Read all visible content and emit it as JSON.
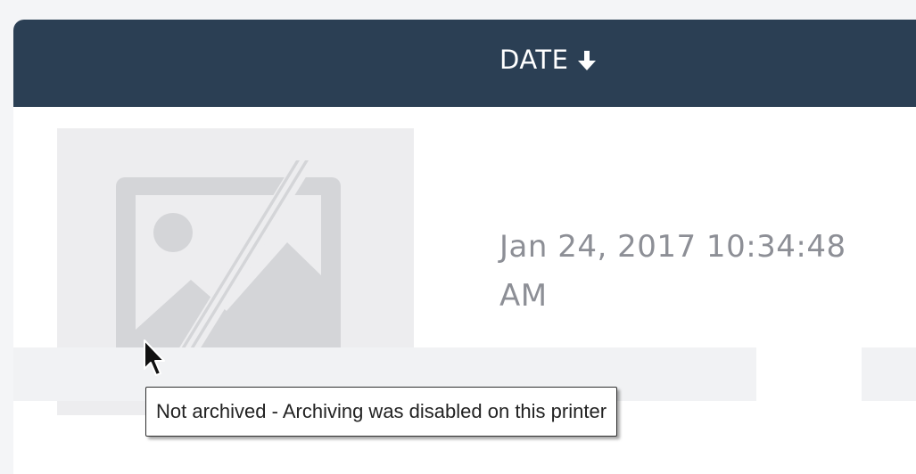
{
  "table": {
    "columns": [
      {
        "label": "DATE",
        "sort_icon": "arrow-down-icon",
        "sort_direction": "descending"
      }
    ],
    "rows": [
      {
        "thumbnail_icon": "image-unavailable-icon",
        "date": "Jan 24, 2017 10:34:48 AM"
      }
    ]
  },
  "tooltip": {
    "text": "Not archived - Archiving was disabled on this printer"
  },
  "cursor": {
    "icon": "mouse-pointer-icon"
  },
  "colors": {
    "header_bg": "#2b3f54",
    "header_text": "#ffffff",
    "date_text": "#8d8f96",
    "thumbnail_bg": "#ededef",
    "thumbnail_icon": "#d4d5d8"
  }
}
